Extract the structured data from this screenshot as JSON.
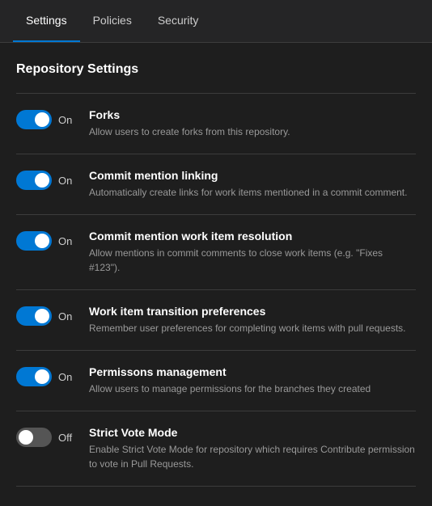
{
  "tabs": [
    {
      "id": "settings",
      "label": "Settings",
      "active": true
    },
    {
      "id": "policies",
      "label": "Policies",
      "active": false
    },
    {
      "id": "security",
      "label": "Security",
      "active": false
    }
  ],
  "section": {
    "title": "Repository Settings"
  },
  "settings": [
    {
      "id": "forks",
      "name": "Forks",
      "description": "Allow users to create forks from this repository.",
      "enabled": true,
      "label_on": "On",
      "label_off": "Off"
    },
    {
      "id": "commit-mention-linking",
      "name": "Commit mention linking",
      "description": "Automatically create links for work items mentioned in a commit comment.",
      "enabled": true,
      "label_on": "On",
      "label_off": "Off"
    },
    {
      "id": "commit-mention-resolution",
      "name": "Commit mention work item resolution",
      "description": "Allow mentions in commit comments to close work items (e.g. \"Fixes #123\").",
      "enabled": true,
      "label_on": "On",
      "label_off": "Off"
    },
    {
      "id": "work-item-transition",
      "name": "Work item transition preferences",
      "description": "Remember user preferences for completing work items with pull requests.",
      "enabled": true,
      "label_on": "On",
      "label_off": "Off"
    },
    {
      "id": "permissions-management",
      "name": "Permissons management",
      "description": "Allow users to manage permissions for the branches they created",
      "enabled": true,
      "label_on": "On",
      "label_off": "Off"
    },
    {
      "id": "strict-vote-mode",
      "name": "Strict Vote Mode",
      "description": "Enable Strict Vote Mode for repository which requires Contribute permission to vote in Pull Requests.",
      "enabled": false,
      "label_on": "On",
      "label_off": "Off"
    }
  ]
}
